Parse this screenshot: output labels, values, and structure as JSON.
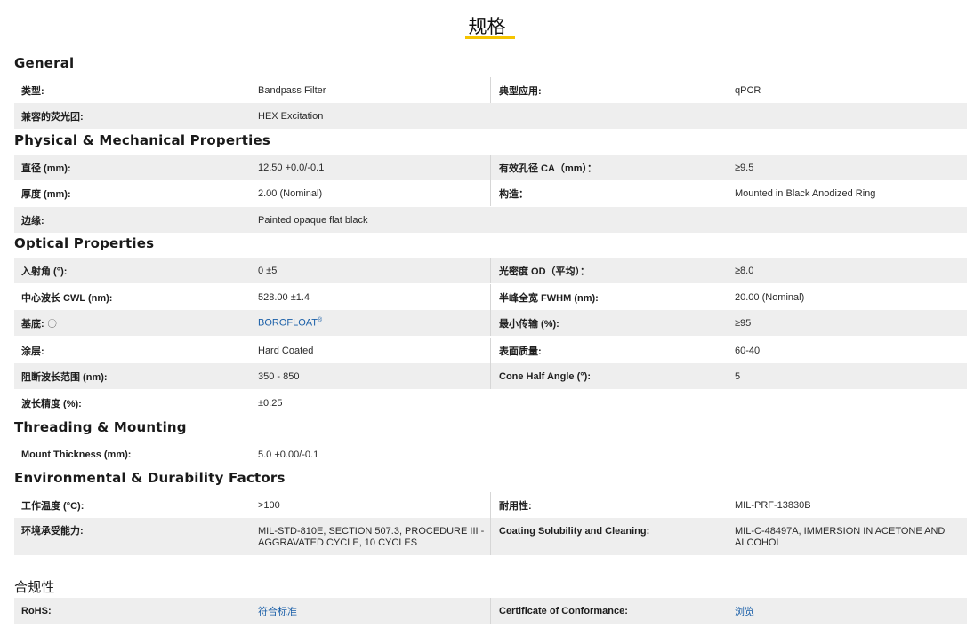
{
  "page": {
    "title": "规格"
  },
  "sections": {
    "general": {
      "title": "General",
      "rows": [
        {
          "l1": "类型:",
          "v1": "Bandpass Filter",
          "l2": "典型应用:",
          "v2": "qPCR"
        },
        {
          "l1": "兼容的荧光团:",
          "v1": "HEX Excitation"
        }
      ]
    },
    "physical": {
      "title": "Physical & Mechanical Properties",
      "rows": [
        {
          "l1": "直径 (mm):",
          "v1": "12.50 +0.0/-0.1",
          "l2": "有效孔径 CA（mm）：",
          "v2": "≥9.5"
        },
        {
          "l1": "厚度 (mm):",
          "v1": "2.00 (Nominal)",
          "l2": "构造：",
          "v2": "Mounted in Black Anodized Ring"
        },
        {
          "l1": "边缘:",
          "v1": "Painted opaque flat black"
        }
      ]
    },
    "optical": {
      "title": "Optical Properties",
      "rows": [
        {
          "l1": "入射角 (°):",
          "v1": "0 ±5",
          "l2": "光密度 OD（平均）：",
          "v2": "≥8.0"
        },
        {
          "l1": "中心波长 CWL (nm):",
          "v1": "528.00 ±1.4",
          "l2": "半峰全宽 FWHM (nm):",
          "v2": "20.00 (Nominal)"
        },
        {
          "l1": "基底:",
          "info": "ⓘ",
          "v1": "BOROFLOAT",
          "v1_sup": "®",
          "l2": "最小传输 (%):",
          "v2": "≥95"
        },
        {
          "l1": "涂层:",
          "v1": "Hard Coated",
          "l2": "表面质量:",
          "v2": "60-40"
        },
        {
          "l1": "阻断波长范围 (nm):",
          "v1": "350 - 850",
          "l2": "Cone Half Angle (°):",
          "v2": "5"
        },
        {
          "l1": "波长精度 (%):",
          "v1": "±0.25"
        }
      ]
    },
    "threading": {
      "title": "Threading & Mounting",
      "rows": [
        {
          "l1": "Mount Thickness (mm):",
          "v1": "5.0 +0.00/-0.1"
        }
      ]
    },
    "environmental": {
      "title": "Environmental & Durability Factors",
      "rows": [
        {
          "l1": "工作温度 (°C):",
          "v1": ">100",
          "l2": "耐用性:",
          "v2": "MIL-PRF-13830B"
        },
        {
          "l1": "环境承受能力:",
          "v1a": "MIL-STD-810E, SECTION 507.3, PROCEDURE III -",
          "v1b": "AGGRAVATED CYCLE, 10 CYCLES",
          "l2": "Coating Solubility and Cleaning:",
          "v2a": "MIL-C-48497A, IMMERSION IN ACETONE AND",
          "v2b": "ALCOHOL"
        }
      ]
    },
    "compliance": {
      "title": "合规性",
      "rows": [
        {
          "l1": "RoHS:",
          "v1": "符合标准",
          "l2": "Certificate of Conformance:",
          "v2": "浏览"
        }
      ]
    }
  },
  "colors": {
    "accent": "#f5c400",
    "link": "#1a5fa8",
    "shade": "#eeeeee"
  }
}
